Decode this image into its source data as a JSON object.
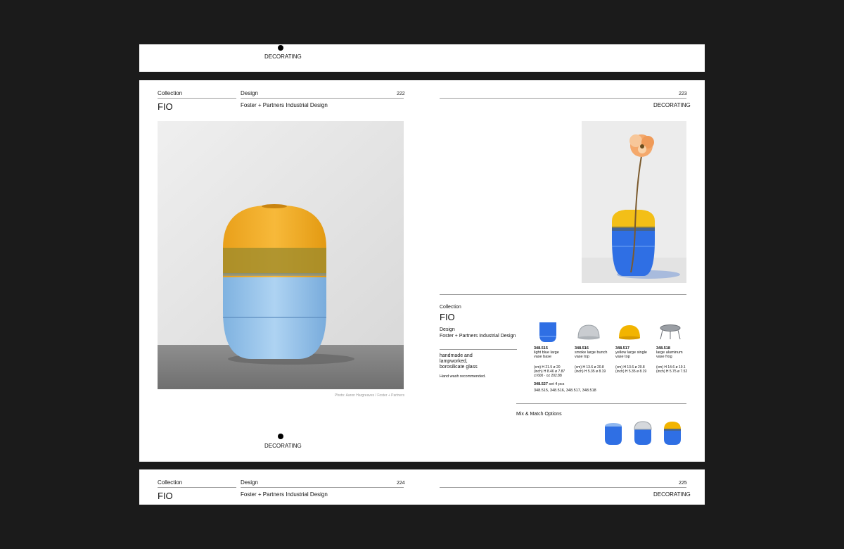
{
  "top_strip": {
    "section": "DECORATING"
  },
  "spread": {
    "left": {
      "collection_label": "Collection",
      "collection_name": "FIO",
      "design_label": "Design",
      "designer": "Foster + Partners Industrial Design",
      "page_number": "222",
      "photo_credit": "Photo: Aaron Hargreaves / Foster + Partners",
      "footer_section": "DECORATING"
    },
    "right": {
      "page_number": "223",
      "section": "DECORATING",
      "collection_label": "Collection",
      "collection_name": "FIO",
      "design_label": "Design",
      "designer": "Foster + Partners Industrial Design",
      "material": [
        "handmade and",
        "lampworked,",
        "borosilicate glass"
      ],
      "care": "Hand wash recommended.",
      "products": [
        {
          "code": "348.515",
          "name": [
            "light blue large",
            "vase base"
          ],
          "dims": [
            "(cm) H 21.5 ø 20",
            "(inch) H 8.46 ø 7.87",
            "cl 600 · oz 202.88"
          ],
          "color": "#3a7be0"
        },
        {
          "code": "348.516",
          "name": [
            "smoke large bunch",
            "vase top"
          ],
          "dims": [
            "(cm) H 13.6 ø 20.8",
            "(inch) H 5.35 ø 8.19"
          ],
          "color": "#b8bcc2"
        },
        {
          "code": "348.517",
          "name": [
            "yellow large single",
            "vase top"
          ],
          "dims": [
            "(cm) H 13.6 ø 20.8",
            "(inch) H 5.35 ø 8.19"
          ],
          "color": "#f2b400"
        },
        {
          "code": "348.518",
          "name": [
            "large aluminum",
            "vase frog"
          ],
          "dims": [
            "(cm) H 14.6 ø 19.1",
            "(inch) H 5.75 ø 7.52"
          ],
          "color": "#9a9ea4"
        }
      ],
      "set": {
        "code": "348.527",
        "label": "set 4 pcs",
        "contents": "348.515, 348.516, 348.517, 348.518"
      },
      "mix_match_label": "Mix & Match Options"
    }
  },
  "next_spread": {
    "left": {
      "collection_label": "Collection",
      "collection_name": "FIO",
      "design_label": "Design",
      "designer": "Foster + Partners Industrial Design",
      "page_number": "224"
    },
    "right": {
      "page_number": "225",
      "section": "DECORATING"
    }
  }
}
